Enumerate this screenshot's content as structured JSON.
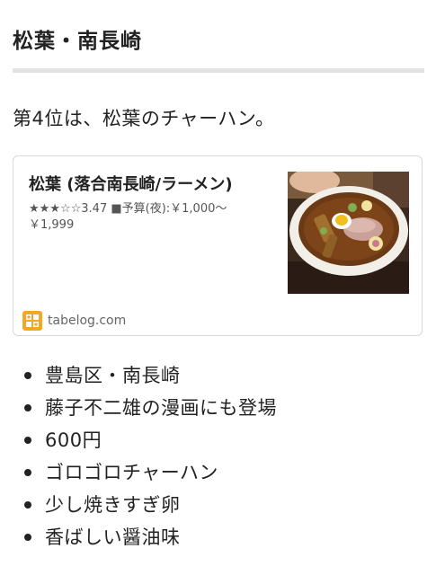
{
  "article": {
    "title": "松葉・南長崎",
    "lead": "第4位は、松葉のチャーハン。"
  },
  "card": {
    "name": "松葉 (落合南長崎/ラーメン)",
    "rating_line": "★★★☆☆3.47 ■予算(夜):￥1,000～",
    "rating_line_2": "￥1,999",
    "domain": "tabelog.com",
    "photo_icon": "ramen-bowl-photo",
    "site_icon": "tabelog-icon"
  },
  "bullets": [
    "豊島区・南長崎",
    "藤子不二雄の漫画にも登場",
    "600円",
    "ゴロゴロチャーハン",
    "少し焼きすぎ卵",
    "香ばしい醤油味"
  ],
  "colors": {
    "text": "#222222",
    "rule": "#e2e2e2",
    "card_border": "#d9d9d9",
    "site_icon": "#f5a623"
  }
}
